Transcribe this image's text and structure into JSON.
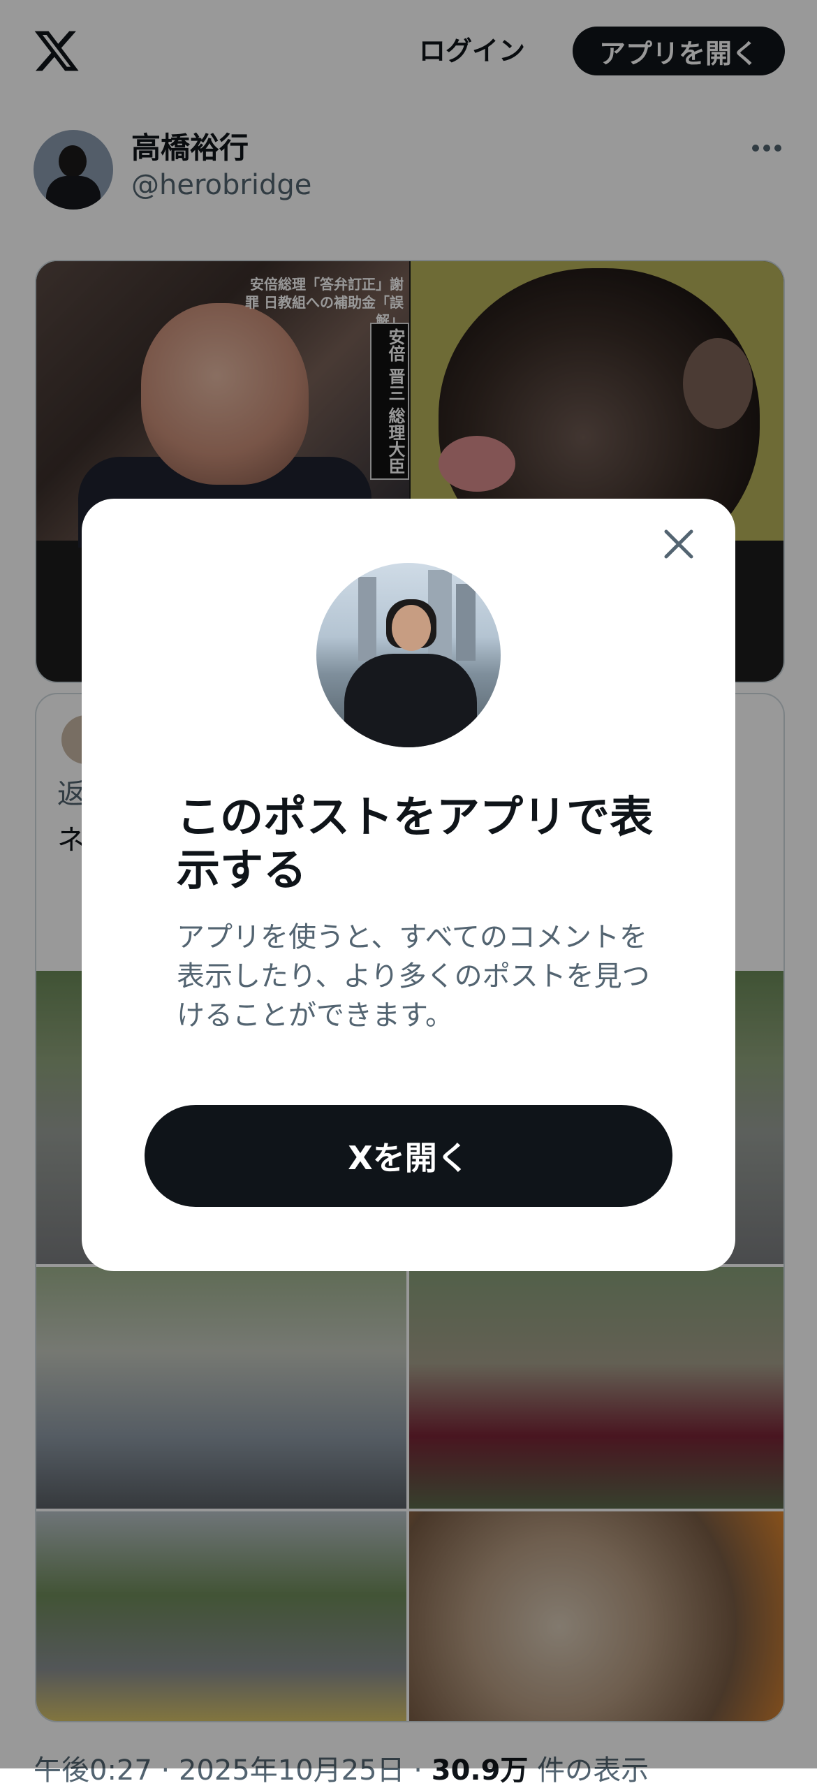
{
  "header": {
    "login_label": "ログイン",
    "open_app_label": "アプリを開く"
  },
  "author": {
    "name": "高橋裕行",
    "handle": "@herobridge"
  },
  "media": {
    "abe_caption": "安倍総理「答弁訂正」謝罪 日教組への補助金「誤解」",
    "abe_nameplate": "安倍 晋三 総理大臣"
  },
  "embedded_post": {
    "line1_partial": "返",
    "line2_partial": "ネ"
  },
  "post_meta": {
    "time": "午後0:27",
    "separator": "·",
    "date": "2025年10月25日",
    "separator2": "·",
    "views_count": "30.9万",
    "views_label": "件の表示"
  },
  "modal": {
    "title": "このポストをアプリで表示する",
    "description": "アプリを使うと、すべてのコメントを表示したり、より多くのポストを見つけることができます。",
    "cta_label": "Xを開く"
  },
  "colors": {
    "primary_text": "#0f1419",
    "secondary_text": "#536471",
    "button_bg": "#0f1419",
    "overlay": "rgba(0,0,0,0.40)"
  }
}
